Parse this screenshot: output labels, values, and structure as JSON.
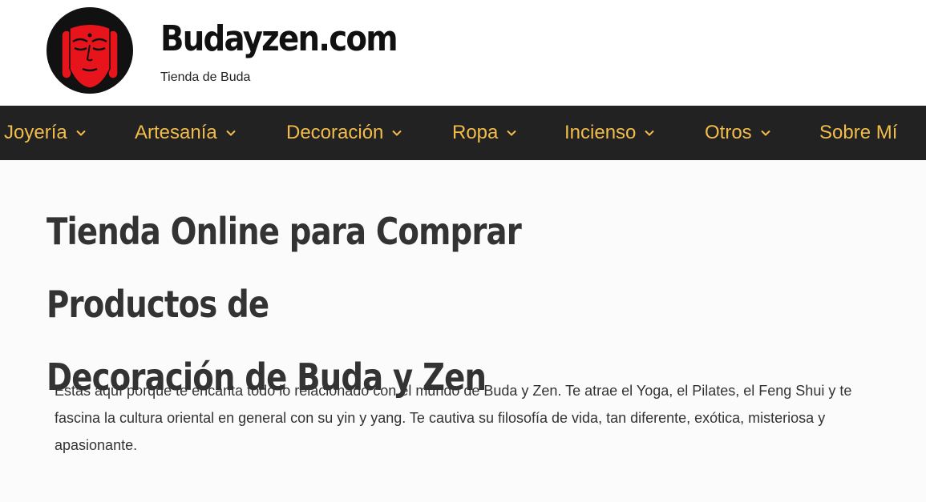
{
  "header": {
    "site_title": "Budayzen.com",
    "tagline": "Tienda de Buda"
  },
  "nav": {
    "items": [
      {
        "label": "Joyería",
        "has_submenu": true
      },
      {
        "label": "Artesanía",
        "has_submenu": true
      },
      {
        "label": "Decoración",
        "has_submenu": true
      },
      {
        "label": "Ropa",
        "has_submenu": true
      },
      {
        "label": "Incienso",
        "has_submenu": true
      },
      {
        "label": "Otros",
        "has_submenu": true
      },
      {
        "label": "Sobre Mí",
        "has_submenu": false
      }
    ]
  },
  "main": {
    "title_line1": "Tienda Online para Comprar Productos de",
    "title_line2": "Decoración de Buda y Zen",
    "intro": "Estás aquí porque te encanta todo lo relacionado con el mundo de Buda y Zen. Te atrae el Yoga, el Pilates, el Feng Shui y te fascina la cultura oriental en general con su yin y yang. Te cautiva su filosofía de vida, tan diferente, exótica, misteriosa y apasionante."
  },
  "colors": {
    "nav_background": "#222222",
    "nav_text": "#f2bc4b",
    "logo_red": "#e8141c",
    "title_text": "#333333"
  },
  "icons": {
    "logo": "buddha-face-logo",
    "submenu": "chevron-down-icon"
  }
}
